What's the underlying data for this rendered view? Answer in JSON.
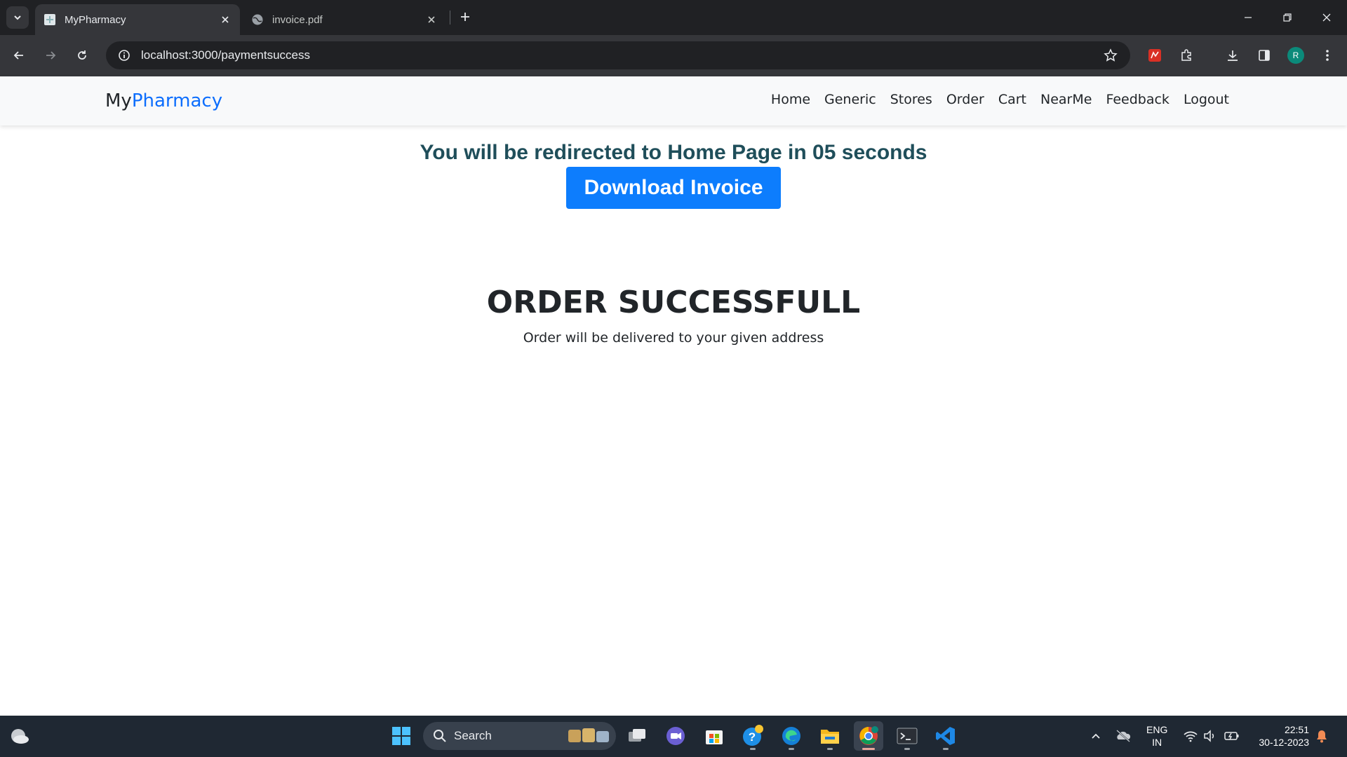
{
  "browser": {
    "tabs": [
      {
        "title": "MyPharmacy",
        "active": true
      },
      {
        "title": "invoice.pdf",
        "active": false
      }
    ],
    "url": "localhost:3000/paymentsuccess",
    "profile_initial": "R"
  },
  "navbar": {
    "brand_prefix": "My",
    "brand_accent": "Pharmacy",
    "links": [
      "Home",
      "Generic",
      "Stores",
      "Order",
      "Cart",
      "NearMe",
      "Feedback",
      "Logout"
    ]
  },
  "main": {
    "redirect_message": "You will be redirected to Home Page in 05 seconds",
    "download_button": "Download Invoice",
    "order_title": "ORDER SUCCESSFULL",
    "order_subtitle": "Order will be delivered to your given address"
  },
  "taskbar": {
    "search_label": "Search",
    "language_line1": "ENG",
    "language_line2": "IN",
    "time": "22:51",
    "date": "30-12-2023"
  },
  "colors": {
    "brand_accent": "#0d6efd",
    "download_button_bg": "#0d7dfd",
    "redirect_text": "#1f4e5a"
  }
}
